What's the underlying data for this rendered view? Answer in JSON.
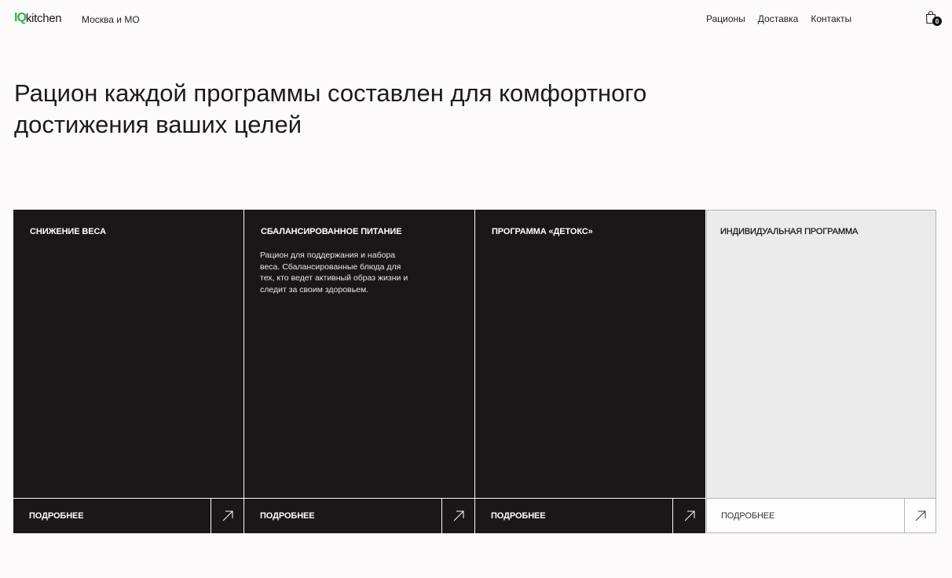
{
  "header": {
    "logo_mark": "IQ",
    "logo_text": "kitchen",
    "region": "Москва и МО",
    "nav": [
      "Рационы",
      "Доставка",
      "Контакты"
    ],
    "cart_count": "0"
  },
  "hero": {
    "title": "Рацион каждой программы составлен для комфортного достижения ваших целей"
  },
  "cards": [
    {
      "title": "СНИЖЕНИЕ ВЕСА",
      "description": "",
      "more_label": "ПОДРОБНЕЕ",
      "theme": "dark"
    },
    {
      "title": "СБАЛАНСИРОВАННОЕ ПИТАНИЕ",
      "description": "Рацион для поддержания и набора веса. Сбалансированные блюда для тех, кто ведет активный образ жизни и следит за своим здоровьем.",
      "more_label": "ПОДРОБНЕЕ",
      "theme": "dark"
    },
    {
      "title": "ПРОГРАММА «ДЕТОКС»",
      "description": "",
      "more_label": "ПОДРОБНЕЕ",
      "theme": "dark"
    },
    {
      "title": "ИНДИВИДУАЛЬНАЯ ПРОГРАММА",
      "description": "",
      "more_label": "ПОДРОБНЕЕ",
      "theme": "light"
    }
  ],
  "colors": {
    "brand_green": "#2fb34a",
    "card_dark": "#191718",
    "card_light": "#ebebeb",
    "background": "#fcfafb"
  },
  "icons": [
    "cart-icon",
    "arrow-up-right-icon"
  ]
}
